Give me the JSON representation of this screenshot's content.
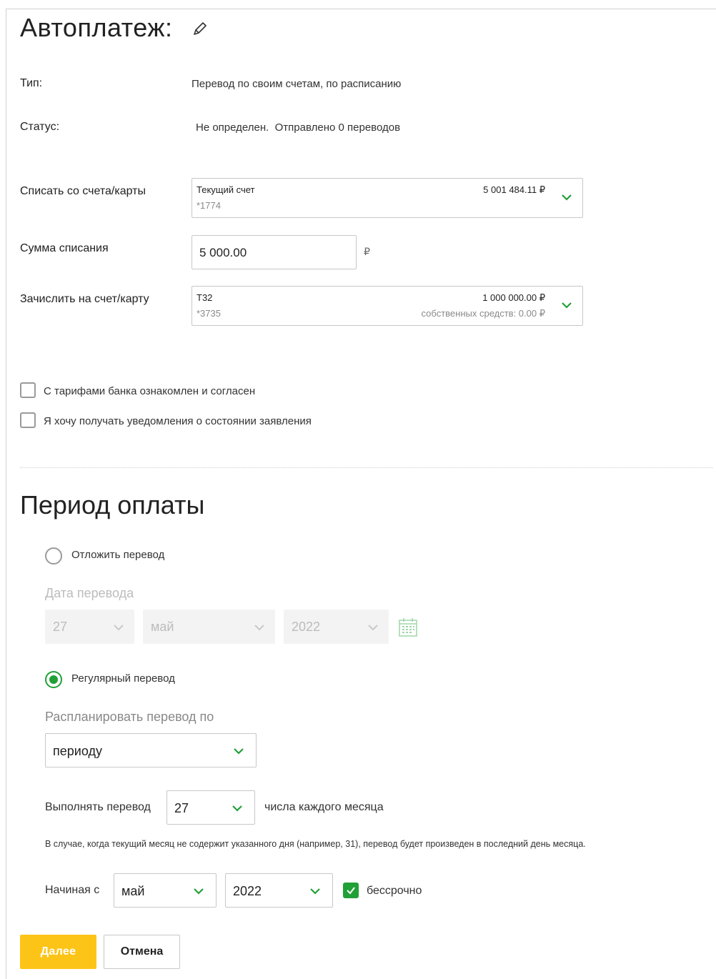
{
  "page": {
    "title": "Автоплатеж:"
  },
  "info": {
    "type_label": "Тип:",
    "type_value": "Перевод по своим счетам, по расписанию",
    "status_label": "Статус:",
    "status_value": "Не определен.  Отправлено 0 переводов"
  },
  "from": {
    "label": "Списать со счета/карты",
    "name": "Текущий счет",
    "number": "*1774",
    "amount": "5 001 484.11 ₽"
  },
  "sum": {
    "label": "Сумма списания",
    "value": "5 000.00",
    "currency": "₽"
  },
  "to": {
    "label": "Зачислить на счет/карту",
    "name": "Т32",
    "number": "*3735",
    "amount": "1 000 000.00 ₽",
    "own_funds": "собственных средств: 0.00 ₽"
  },
  "checkboxes": {
    "tariffs": "С тарифами банка ознакомлен и согласен",
    "notifications": "Я хочу получать уведомления о состоянии заявления"
  },
  "period": {
    "title": "Период оплаты",
    "defer_label": "Отложить перевод",
    "date_label": "Дата перевода",
    "day": "27",
    "month": "май",
    "year": "2022",
    "regular_label": "Регулярный перевод",
    "schedule_label": "Распланировать перевод по",
    "schedule_value": "периоду",
    "execute_label": "Выполнять перевод",
    "execute_day": "27",
    "execute_suffix": "числа каждого месяца",
    "note": "В случае, когда текущий месяц не содержит указанного дня (например, 31), перевод будет произведен в последний день месяца.",
    "start_label": "Начиная с",
    "start_month": "май",
    "start_year": "2022",
    "indefinite_label": "бессрочно",
    "indefinite_checked": true
  },
  "buttons": {
    "next": "Далее",
    "cancel": "Отмена"
  },
  "colors": {
    "accent": "#21a038",
    "primary_button": "#fdc418"
  },
  "icons": [
    "pencil-icon",
    "chevron-down-icon",
    "calendar-icon",
    "check-icon"
  ]
}
